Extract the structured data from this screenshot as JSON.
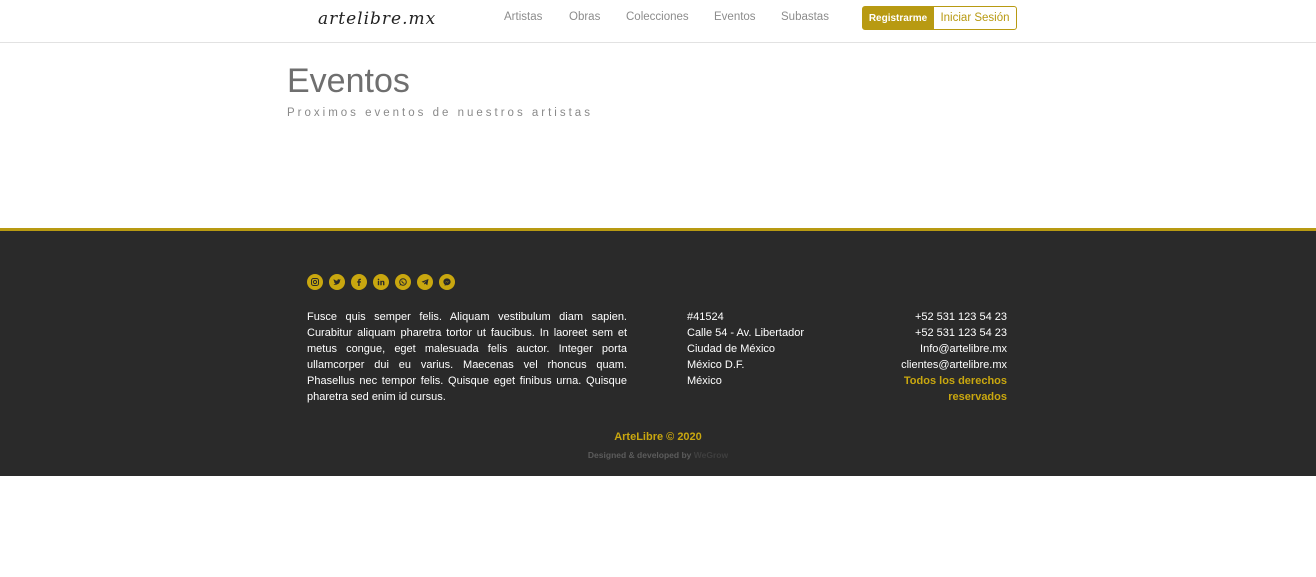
{
  "header": {
    "logo": "artelibre.mx",
    "nav": [
      "Artistas",
      "Obras",
      "Colecciones",
      "Eventos",
      "Subastas"
    ],
    "register_label": "Registrarme",
    "login_label": "Iniciar Sesión"
  },
  "page": {
    "title": "Eventos",
    "subtitle": "Proximos eventos de nuestros artistas"
  },
  "footer": {
    "social_icons": [
      "instagram-icon",
      "twitter-icon",
      "facebook-icon",
      "linkedin-icon",
      "whatsapp-icon",
      "telegram-icon",
      "messenger-icon"
    ],
    "about": "Fusce quis semper felis. Aliquam vestibulum diam sapien. Curabitur aliquam pharetra tortor ut faucibus. In laoreet sem et metus congue, eget malesuada felis auctor. Integer porta ullamcorper dui eu varius. Maecenas vel rhoncus quam. Phasellus nec tempor felis. Quisque eget finibus urna. Quisque pharetra sed enim id cursus.",
    "address": [
      "#41524",
      "Calle 54 - Av. Libertador",
      "Ciudad de México",
      "México D.F.",
      "México"
    ],
    "contact": {
      "phone1": "+52 531 123 54 23",
      "phone2": "+52 531 123 54 23",
      "email_info": "Info@artelibre.mx",
      "email_clients": "clientes@artelibre.mx",
      "rights": "Todos los derechos reservados"
    },
    "copyright": "ArteLibre © 2020",
    "credits_prefix": "Designed & developed by",
    "credits_brand": "WeGrow"
  },
  "colors": {
    "accent": "#b89a12",
    "footer_bg": "#2a2a2a"
  }
}
